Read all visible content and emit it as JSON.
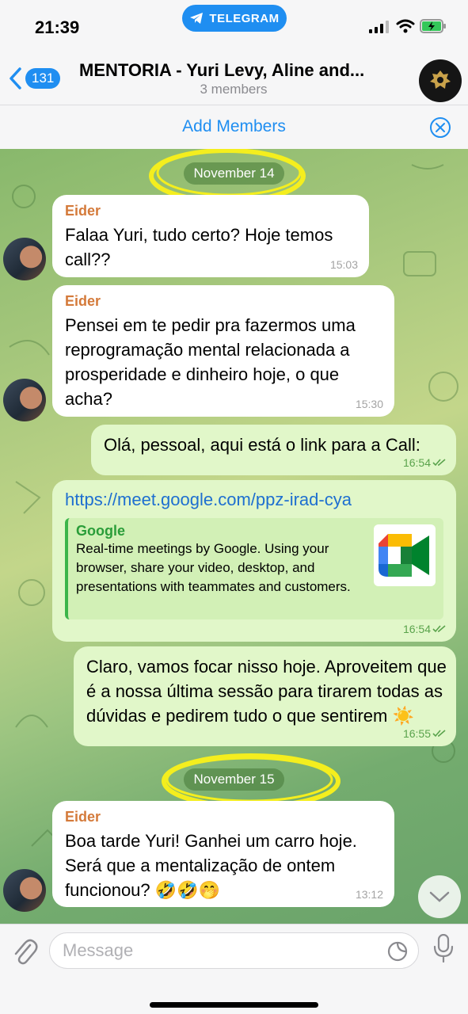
{
  "status": {
    "time": "21:39",
    "pill": "TELEGRAM"
  },
  "header": {
    "unread_count": "131",
    "title": "MENTORIA - Yuri Levy, Aline and...",
    "subtitle": "3 members"
  },
  "add_members": "Add Members",
  "dates": [
    "November 14",
    "November 15"
  ],
  "messages": [
    {
      "sender": "Eider",
      "text": "Falaa Yuri, tudo certo? Hoje temos call??",
      "time": "15:03"
    },
    {
      "sender": "Eider",
      "text": "Pensei em te pedir pra fazermos uma reprogramação mental relacionada a prosperidade e dinheiro hoje, o que acha?",
      "time": "15:30"
    },
    {
      "text": "Olá, pessoal, aqui está o link para a Call:",
      "time": "16:54"
    },
    {
      "link": "https://meet.google.com/ppz-irad-cya",
      "preview_site": "Google",
      "preview_desc": "Real-time meetings by Google. Using your browser, share your video, desktop, and presentations with teammates and customers.",
      "time": "16:54"
    },
    {
      "text": "Claro, vamos focar nisso hoje. Aproveitem que é a nossa última sessão para tirarem todas as dúvidas e pedirem tudo o que sentirem ☀️",
      "time": "16:55"
    },
    {
      "sender": "Eider",
      "text": "Boa tarde Yuri! Ganhei um carro hoje. Será que a mentalização de ontem funcionou? 🤣🤣🤭",
      "time": "13:12"
    }
  ],
  "input": {
    "placeholder": "Message"
  },
  "colors": {
    "accent": "#1f8ef1",
    "sender": "#d47a3a",
    "outgoing": "#e1f7c9",
    "preview_bar": "#3cb54a",
    "highlight": "#f4ee1e"
  }
}
